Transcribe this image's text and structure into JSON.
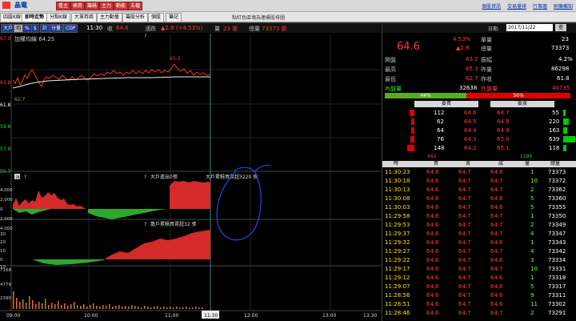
{
  "topbar": {
    "stock": "晶電",
    "buttons": [
      "看主",
      "帳券",
      "籌碼",
      "主力",
      "動能",
      "五檔"
    ],
    "links": [
      "個股資訊",
      "交易量排",
      "行事曆",
      "刷機備知"
    ]
  },
  "tabs": [
    "四股K線",
    "即時走勢",
    "分點K線",
    "大單券商",
    "主力動量",
    "籌股分析",
    "個股",
    "筆記"
  ],
  "notice": "點紅色區塊為連續股排圖",
  "toolbar": {
    "buttons": [
      "大戶",
      "均",
      "%",
      "$",
      "計",
      "分量",
      "CDP"
    ],
    "time": "11:30",
    "close_label": "收",
    "close_val": "64.6",
    "change_label": "漲跌",
    "change_val": "▲2.8 (+4.53%)",
    "vol_label": "量",
    "vol_val": "23 張",
    "total_label": "總量",
    "total_val": "73373 張"
  },
  "chart": {
    "legend": "加權均線 64.25",
    "high_label": "65.3",
    "low_label": "62.7",
    "left_axis": [
      "67.9",
      "63.8",
      "61.8",
      "59.8",
      "57.9",
      "55.7"
    ],
    "panel2_label1": "大戶進出0張",
    "panel2_label2": "大戶累積買賣超3220 張",
    "panel2_axis": [
      "4,000",
      "2,000",
      "0",
      "2,000",
      "4,000"
    ],
    "panel3_label": "散戶累積買賣超32 張",
    "panel3_axis": [
      "30",
      "20",
      "10",
      "0",
      "10"
    ],
    "panel4_axis": [
      "7168",
      "4779",
      "2390"
    ],
    "panel1_help": "?",
    "panel2_tag": "說",
    "panel2_help_left": "?",
    "panel2_help_right": "?",
    "panel3_help": "?",
    "x_axis": [
      "09:00",
      "10:00",
      "11:00",
      "11:30",
      "12:00",
      "13:00",
      "13:30"
    ]
  },
  "right": {
    "date_label": "日期:",
    "date": "2017/11/22",
    "go": "查",
    "price": "64.6",
    "pct": "4.53%",
    "chg": "▲2.8",
    "single_label": "單量",
    "single_val": "23",
    "total_label": "總量",
    "total_val": "73373",
    "rows": [
      {
        "l": "開盤",
        "v": "63.2",
        "l2": "振幅",
        "v2": "4.2%"
      },
      {
        "l": "最高",
        "v": "65.3",
        "l2": "昨量",
        "v2": "86298"
      },
      {
        "l": "最低",
        "v": "62.7",
        "l2": "昨收",
        "v2": "61.8"
      }
    ],
    "inner_label": "內盤量",
    "inner_val": "32638",
    "outer_label": "外盤量",
    "outer_val": "40735",
    "pct_left": "44%",
    "pct_right": "56%",
    "buy_hdr": "委買",
    "sell_hdr": "委賣",
    "book": [
      {
        "bq": "112",
        "bp": "64.6",
        "sp": "64.7",
        "sq": "55"
      },
      {
        "bq": "62",
        "bp": "64.5",
        "sp": "64.8",
        "sq": "220"
      },
      {
        "bq": "64",
        "bp": "64.4",
        "sp": "64.9",
        "sq": "163"
      },
      {
        "bq": "76",
        "bp": "64.3",
        "sp": "65.0",
        "sq": "639"
      },
      {
        "bq": "148",
        "bp": "64.2",
        "sp": "65.1",
        "sq": "118"
      }
    ],
    "book_total_buy": "462",
    "book_total_sell": "1195",
    "tick_headers": [
      "時",
      "買",
      "賣",
      "成",
      "量",
      "總量"
    ],
    "ticks": [
      [
        "11:30:23",
        "64.6",
        "64.7",
        "64.6",
        "1",
        "73373"
      ],
      [
        "11:30:18",
        "64.6",
        "64.7",
        "64.7",
        "10",
        "73372"
      ],
      [
        "11:30:13",
        "64.6",
        "64.7",
        "64.7",
        "2",
        "73362"
      ],
      [
        "11:30:08",
        "64.6",
        "64.7",
        "64.6",
        "5",
        "73360"
      ],
      [
        "11:30:03",
        "64.6",
        "64.7",
        "64.6",
        "5",
        "73355"
      ],
      [
        "11:29:58",
        "64.6",
        "64.7",
        "64.7",
        "1",
        "73350"
      ],
      [
        "11:29:53",
        "64.6",
        "64.7",
        "64.7",
        "2",
        "73349"
      ],
      [
        "11:29:37",
        "64.6",
        "64.7",
        "64.7",
        "4",
        "73347"
      ],
      [
        "11:29:32",
        "64.6",
        "64.7",
        "64.6",
        "1",
        "73343"
      ],
      [
        "11:29:27",
        "64.6",
        "64.7",
        "64.7",
        "4",
        "73342"
      ],
      [
        "11:29:22",
        "64.6",
        "64.7",
        "64.6",
        "3",
        "73334"
      ],
      [
        "11:29:17",
        "64.6",
        "64.7",
        "64.7",
        "10",
        "73331"
      ],
      [
        "11:29:12",
        "64.6",
        "64.7",
        "64.6",
        "1",
        "73318"
      ],
      [
        "11:29:07",
        "64.6",
        "64.7",
        "64.6",
        "5",
        "73317"
      ],
      [
        "11:28:56",
        "64.6",
        "64.7",
        "64.6",
        "9",
        "73311"
      ],
      [
        "11:28:51",
        "64.6",
        "64.7",
        "64.6",
        "11",
        "73302"
      ],
      [
        "11:28:46",
        "64.6",
        "64.7",
        "64.7",
        "2",
        "73291"
      ]
    ]
  },
  "colors": {
    "up": "#ff3a3a",
    "down": "#2fdc2f",
    "bg": "#000000"
  }
}
